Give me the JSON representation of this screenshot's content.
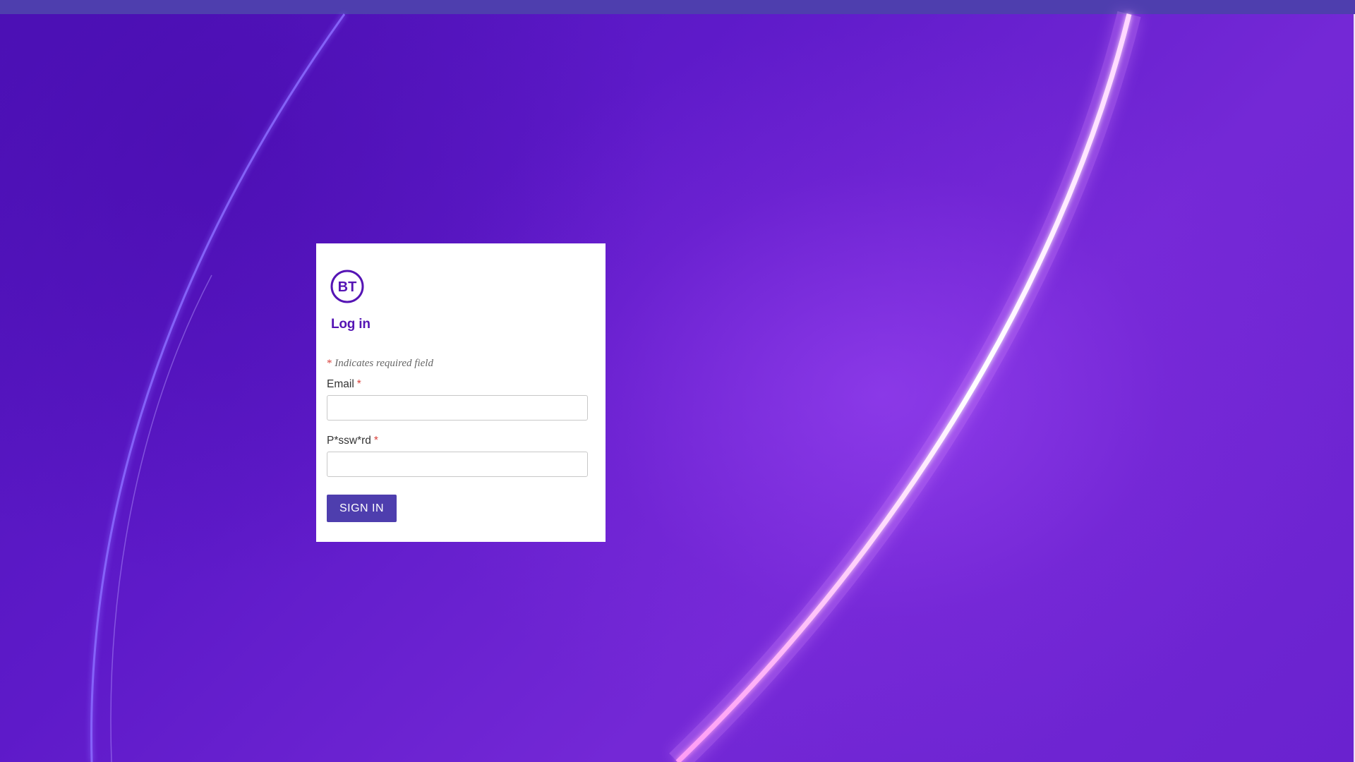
{
  "brand": {
    "logo_text": "BT",
    "color": "#5514b4"
  },
  "login": {
    "title": "Log in",
    "required_note_symbol": "*",
    "required_note_text": "Indicates required field",
    "email": {
      "label": "Email",
      "required_symbol": "*",
      "value": "",
      "placeholder": ""
    },
    "password": {
      "label": "P*ssw*rd",
      "required_symbol": "*",
      "value": "",
      "placeholder": ""
    },
    "submit_label": "SIGN IN"
  },
  "colors": {
    "background": "#5a18c6",
    "topbar": "#4e3eae",
    "button": "#4e3eae",
    "required": "#d8403a"
  }
}
